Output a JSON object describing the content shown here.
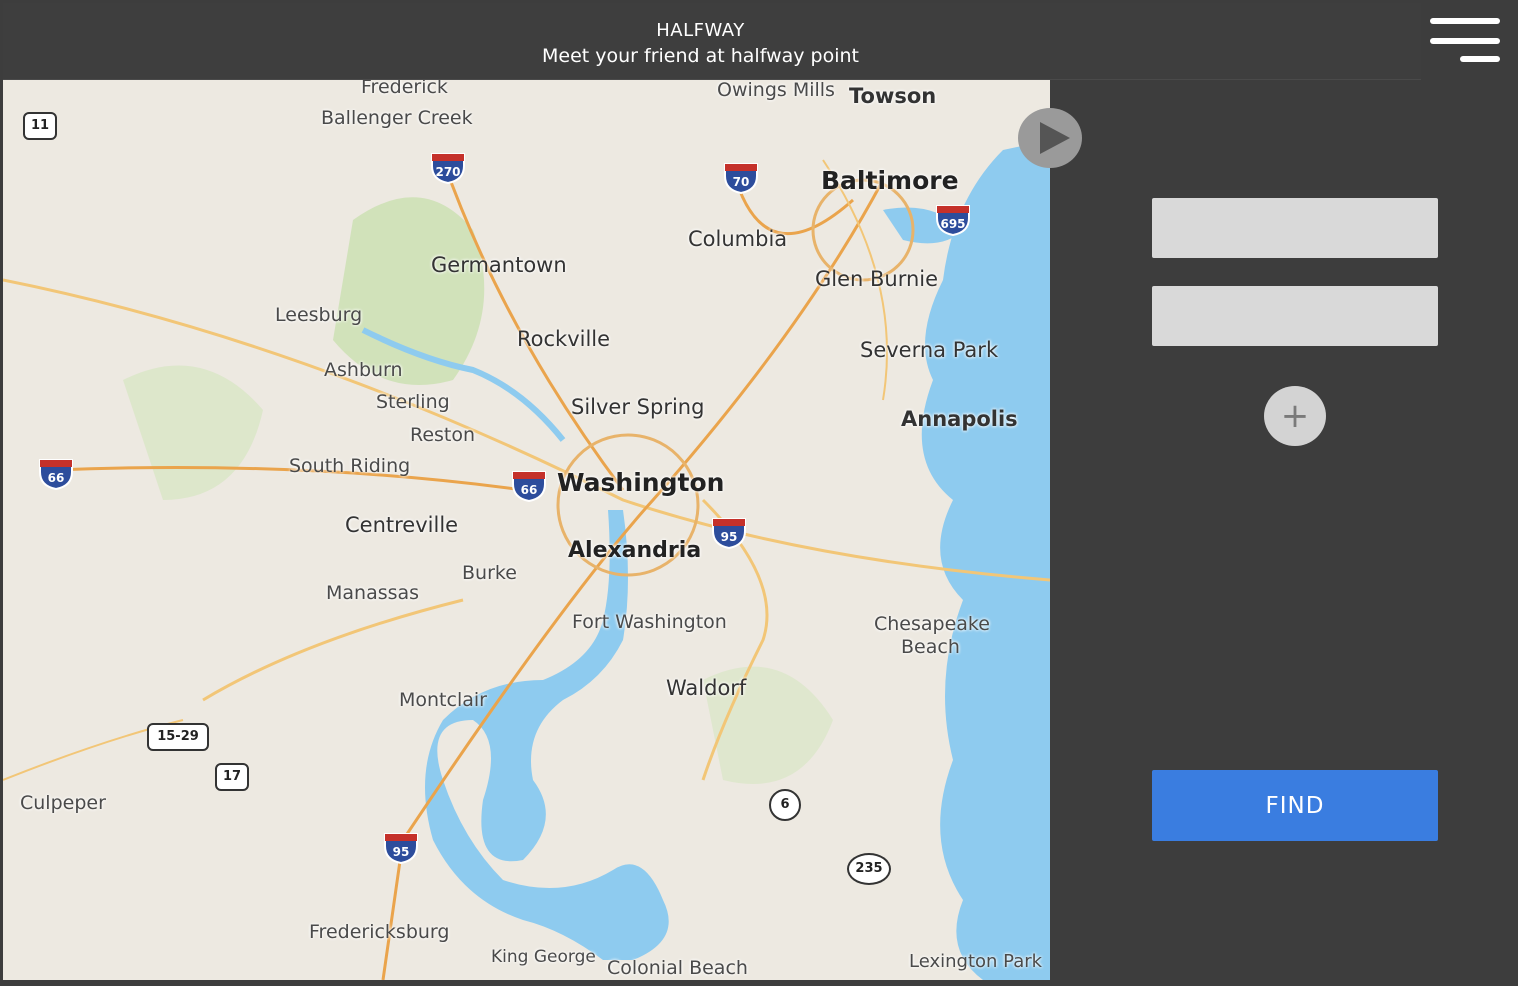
{
  "header": {
    "title": "HALFWAY",
    "subtitle": "Meet your friend at halfway point"
  },
  "menu": {
    "icon": "hamburger-menu-icon"
  },
  "map": {
    "places": [
      {
        "label": "Frederick",
        "style": "mid"
      },
      {
        "label": "Ballenger Creek",
        "style": "mid"
      },
      {
        "label": "Owings Mills",
        "style": "mid"
      },
      {
        "label": "Towson",
        "style": "mid"
      },
      {
        "label": "Baltimore",
        "style": "big"
      },
      {
        "label": "Columbia",
        "style": "mid"
      },
      {
        "label": "Glen Burnie",
        "style": "mid"
      },
      {
        "label": "Germantown",
        "style": "mid"
      },
      {
        "label": "Leesburg",
        "style": ""
      },
      {
        "label": "Rockville",
        "style": "mid"
      },
      {
        "label": "Severna Park",
        "style": "mid"
      },
      {
        "label": "Ashburn",
        "style": ""
      },
      {
        "label": "Sterling",
        "style": ""
      },
      {
        "label": "Silver Spring",
        "style": "mid"
      },
      {
        "label": "Reston",
        "style": ""
      },
      {
        "label": "Annapolis",
        "style": "mid"
      },
      {
        "label": "South Riding",
        "style": ""
      },
      {
        "label": "Washington",
        "style": "big"
      },
      {
        "label": "Centreville",
        "style": "mid"
      },
      {
        "label": "Alexandria",
        "style": "big"
      },
      {
        "label": "Burke",
        "style": ""
      },
      {
        "label": "Manassas",
        "style": ""
      },
      {
        "label": "Fort Washington",
        "style": ""
      },
      {
        "label": "Chesapeake",
        "style": ""
      },
      {
        "label": "Beach",
        "style": ""
      },
      {
        "label": "Waldorf",
        "style": "mid"
      },
      {
        "label": "Montclair",
        "style": ""
      },
      {
        "label": "Culpeper",
        "style": ""
      },
      {
        "label": "Fredericksburg",
        "style": ""
      },
      {
        "label": "King George",
        "style": ""
      },
      {
        "label": "Colonial Beach",
        "style": ""
      },
      {
        "label": "Lexington Park",
        "style": ""
      }
    ],
    "interstates": [
      "270",
      "70",
      "695",
      "66",
      "66",
      "95",
      "95"
    ],
    "us_routes": [
      "11",
      "15-29",
      "17"
    ],
    "state_routes": [
      "6",
      "235"
    ]
  },
  "controls": {
    "play_icon": "play-icon",
    "address_1": {
      "value": "",
      "placeholder": ""
    },
    "address_2": {
      "value": "",
      "placeholder": ""
    },
    "add_label": "+",
    "find_label": "FIND"
  },
  "colors": {
    "header_bg": "#3e3e3e",
    "panel_bg": "#3d3d3d",
    "find_button": "#3a7de0",
    "input_bg": "#d9d9d9",
    "water": "#8ecbef",
    "land": "#ede9e1"
  }
}
